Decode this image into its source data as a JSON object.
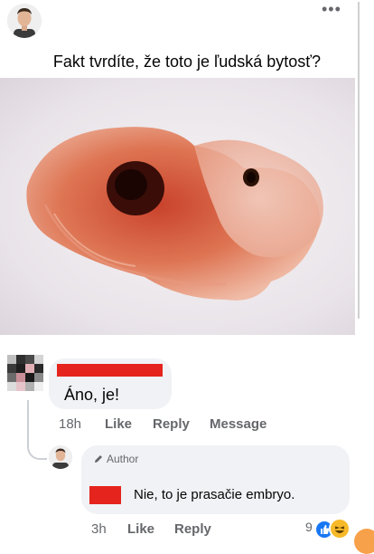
{
  "post": {
    "text": "Fakt tvrdíte, že toto je ľudská bytosť?",
    "menu_icon": "more-dots-icon"
  },
  "comment1": {
    "text": "Áno, je!",
    "actions": {
      "time": "18h",
      "like": "Like",
      "reply": "Reply",
      "message": "Message"
    }
  },
  "comment2": {
    "badge": "Author",
    "text": "Nie, to je prasačie embryo.",
    "actions": {
      "time": "3h",
      "like": "Like",
      "reply": "Reply"
    },
    "reaction_count": "9",
    "reaction_icons": [
      "like-icon",
      "haha-icon"
    ]
  },
  "colors": {
    "redaction": "#e5241d",
    "bubble": "#f0f2f5",
    "meta_text": "#65676b",
    "like_blue": "#1877f2",
    "haha_yellow": "#f7b928"
  }
}
